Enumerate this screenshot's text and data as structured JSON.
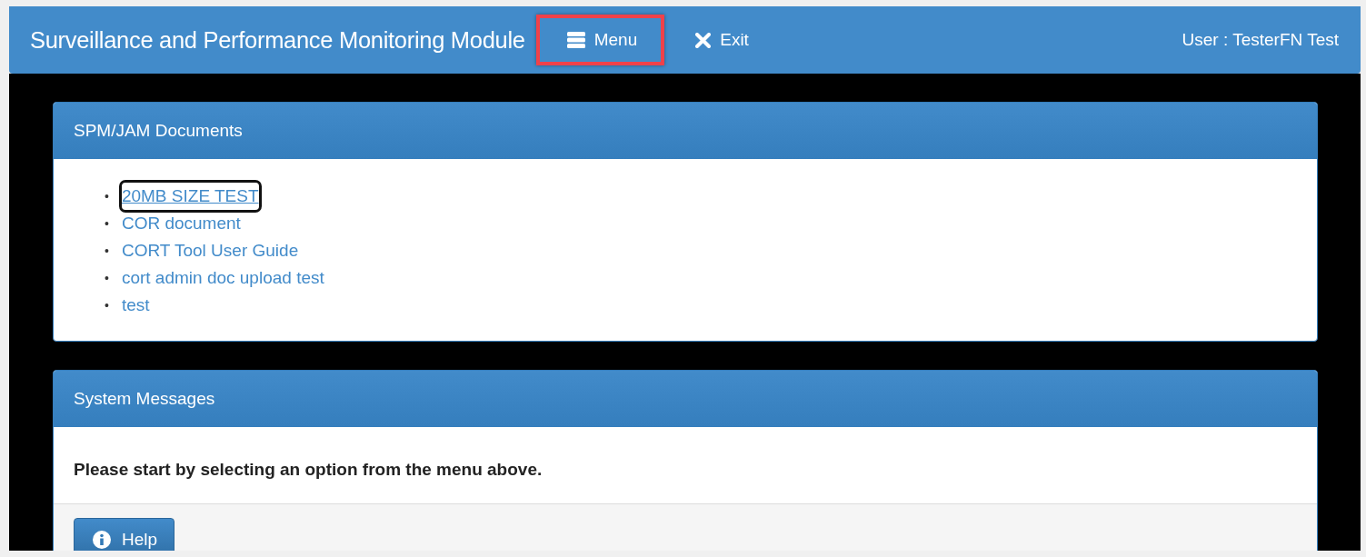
{
  "navbar": {
    "title": "Surveillance and Performance Monitoring Module",
    "items": [
      {
        "kind": "menu",
        "label": "Menu",
        "highlighted": true
      },
      {
        "kind": "exit",
        "label": "Exit",
        "highlighted": false
      }
    ],
    "user": "User : TesterFN Test"
  },
  "documents_panel": {
    "title": "SPM/JAM Documents",
    "links": [
      {
        "bullet": "•",
        "label": "20MB SIZE TEST",
        "focused": true
      },
      {
        "bullet": "•",
        "label": "COR document",
        "focused": false
      },
      {
        "bullet": "•",
        "label": "CORT Tool User Guide",
        "focused": false
      },
      {
        "bullet": "•",
        "label": "cort admin doc upload test",
        "focused": false
      },
      {
        "bullet": "•",
        "label": "test",
        "focused": false
      }
    ]
  },
  "messages_panel": {
    "title": "System Messages",
    "message": "Please start by selecting an option from the menu above.",
    "buttons": [
      {
        "kind": "help",
        "label": "Help"
      }
    ]
  }
}
